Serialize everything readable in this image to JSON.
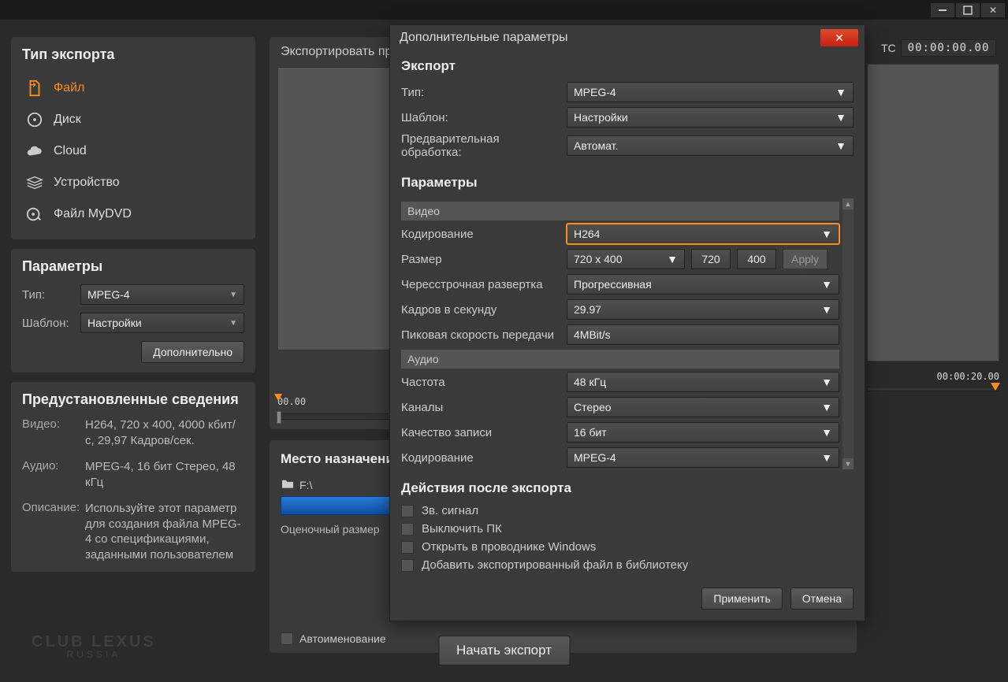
{
  "titlebar": {},
  "left": {
    "export_type_title": "Тип экспорта",
    "types": [
      {
        "label": "Файл",
        "icon": "file-export-icon",
        "active": true
      },
      {
        "label": "Диск",
        "icon": "disc-icon",
        "active": false
      },
      {
        "label": "Cloud",
        "icon": "cloud-icon",
        "active": false
      },
      {
        "label": "Устройство",
        "icon": "device-icon",
        "active": false
      },
      {
        "label": "Файл MyDVD",
        "icon": "mydvd-icon",
        "active": false
      }
    ],
    "params_title": "Параметры",
    "type_label": "Тип:",
    "type_value": "MPEG-4",
    "template_label": "Шаблон:",
    "template_value": "Настройки",
    "advanced_btn": "Дополнительно",
    "preset_title": "Предустановленные сведения",
    "video_k": "Видео:",
    "video_v": "H264, 720 x 400, 4000 кбит/с, 29,97 Кадров/сек.",
    "audio_k": "Аудио:",
    "audio_v": "MPEG-4, 16 бит Стерео, 48 кГц",
    "desc_k": "Описание:",
    "desc_v": "Используйте этот параметр для создания файла MPEG-4 со спецификациями, заданными пользователем"
  },
  "center": {
    "preview_title": "Экспортировать пр",
    "timecode_left": "00.00",
    "dest_title": "Место назначения",
    "path": "F:\\",
    "est_label": "Оценочный размер",
    "auto_naming": "Автоименование"
  },
  "right": {
    "tc_label": "TC",
    "tc_value": "00:00:00.00",
    "time_end": "00:00:20.00"
  },
  "modal": {
    "title": "Дополнительные параметры",
    "export_h": "Экспорт",
    "type_l": "Тип:",
    "type_v": "MPEG-4",
    "tmpl_l": "Шаблон:",
    "tmpl_v": "Настройки",
    "pre_l": "Предварительная обработка:",
    "pre_v": "Автомат.",
    "params_h": "Параметры",
    "video_hdr": "Видео",
    "enc_l": "Кодирование",
    "enc_v": "H264",
    "size_l": "Размер",
    "size_v": "720 x 400",
    "size_w": "720",
    "size_h": "400",
    "apply": "Apply",
    "scan_l": "Чересстрочная развертка",
    "scan_v": "Прогрессивная",
    "fps_l": "Кадров в секунду",
    "fps_v": "29.97",
    "peak_l": "Пиковая скорость передачи",
    "peak_v": "4MBit/s",
    "audio_hdr": "Аудио",
    "freq_l": "Частота",
    "freq_v": "48 кГц",
    "ch_l": "Каналы",
    "ch_v": "Стерео",
    "q_l": "Качество записи",
    "q_v": "16 бит",
    "aenc_l": "Кодирование",
    "aenc_v": "MPEG-4",
    "after_h": "Действия после экспорта",
    "chk1": "Зв. сигнал",
    "chk2": "Выключить ПК",
    "chk3": "Открыть в проводнике Windows",
    "chk4": "Добавить экспортированный файл в библиотеку",
    "apply_btn": "Применить",
    "cancel_btn": "Отмена"
  },
  "footer": {
    "begin": "Начать экспорт"
  },
  "watermark": {
    "l1": "CLUB LEXUS",
    "l2": "RUSSIA"
  }
}
